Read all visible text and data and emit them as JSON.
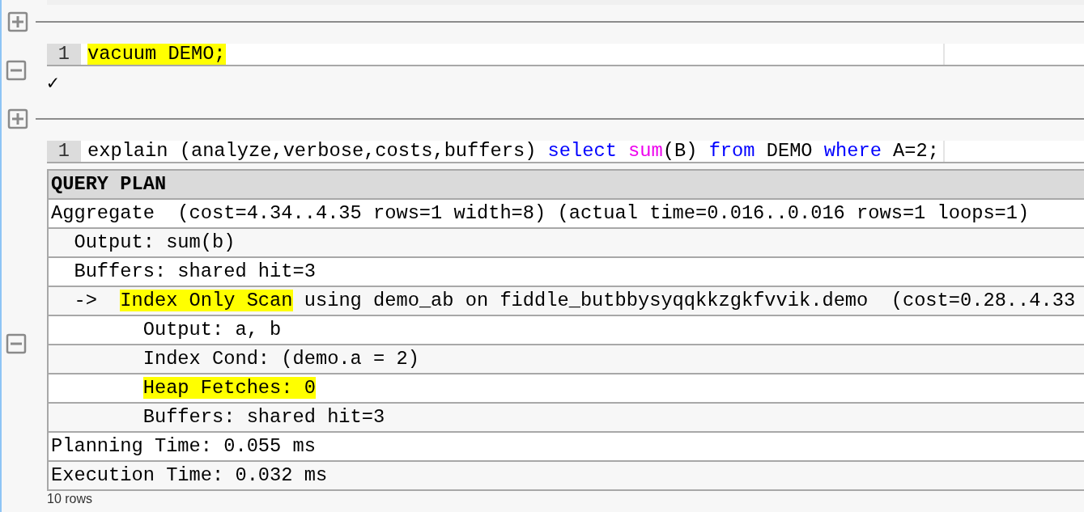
{
  "batches": [
    {
      "line_number": "1",
      "code": [
        {
          "kind": "plain",
          "text": "vacuum DEMO;",
          "highlighted": true
        }
      ],
      "result": {
        "kind": "status",
        "text": "✓"
      }
    },
    {
      "line_number": "1",
      "code": [
        {
          "kind": "plain",
          "text": "explain (analyze,verbose,costs,buffers) ",
          "highlighted": false
        },
        {
          "kind": "keyword",
          "text": "select ",
          "highlighted": false
        },
        {
          "kind": "function",
          "text": "sum",
          "highlighted": false
        },
        {
          "kind": "plain",
          "text": "(B) ",
          "highlighted": false
        },
        {
          "kind": "keyword",
          "text": "from",
          "highlighted": false
        },
        {
          "kind": "plain",
          "text": " DEMO ",
          "highlighted": false
        },
        {
          "kind": "keyword",
          "text": "where",
          "highlighted": false
        },
        {
          "kind": "plain",
          "text": " A=2;",
          "highlighted": false
        }
      ],
      "result": {
        "kind": "table",
        "column": "QUERY PLAN",
        "rows": [
          {
            "segments": [
              {
                "text": "Aggregate  (cost=4.34..4.35 rows=1 width=8) (actual time=0.016..0.016 rows=1 loops=1)",
                "highlighted": false
              }
            ]
          },
          {
            "segments": [
              {
                "text": "  Output: sum(b)",
                "highlighted": false
              }
            ]
          },
          {
            "segments": [
              {
                "text": "  Buffers: shared hit=3",
                "highlighted": false
              }
            ]
          },
          {
            "segments": [
              {
                "text": "  ->  ",
                "highlighted": false
              },
              {
                "text": "Index Only Scan",
                "highlighted": true
              },
              {
                "text": " using demo_ab on fiddle_butbbysyqqkkzgkfvvik.demo  (cost=0.28..4.33",
                "highlighted": false
              }
            ]
          },
          {
            "segments": [
              {
                "text": "        Output: a, b",
                "highlighted": false
              }
            ]
          },
          {
            "segments": [
              {
                "text": "        Index Cond: (demo.a = 2)",
                "highlighted": false
              }
            ]
          },
          {
            "segments": [
              {
                "text": "        Heap Fetches: 0",
                "highlighted": true
              }
            ]
          },
          {
            "segments": [
              {
                "text": "        Buffers: shared hit=3",
                "highlighted": false
              }
            ]
          },
          {
            "segments": [
              {
                "text": "Planning Time: 0.055 ms",
                "highlighted": false
              }
            ]
          },
          {
            "segments": [
              {
                "text": "Execution Time: 0.032 ms",
                "highlighted": false
              }
            ]
          }
        ],
        "footer": "10 rows"
      }
    }
  ]
}
